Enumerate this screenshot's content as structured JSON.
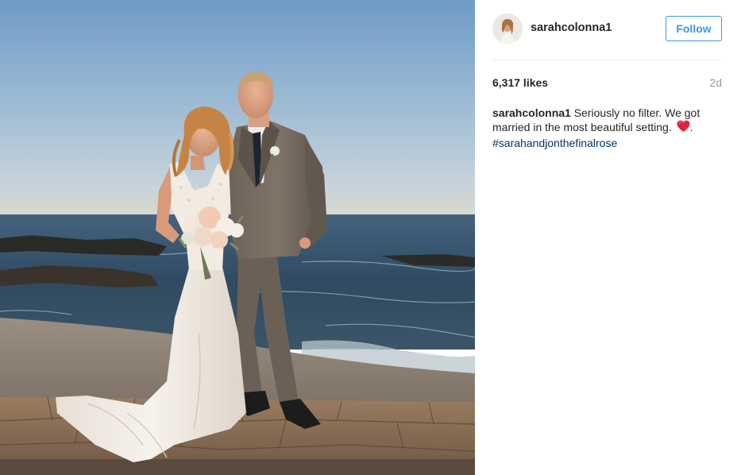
{
  "photo": {
    "alt": "wedding-photo-couple-on-beach"
  },
  "header": {
    "username": "sarahcolonna1",
    "follow_label": "Follow",
    "avatar_icon": "user-avatar"
  },
  "stats": {
    "likes": "6,317 likes",
    "age": "2d"
  },
  "caption": {
    "user": "sarahcolonna1",
    "text": "Seriously no filter. We got married in the most beautiful setting.",
    "emoji_icon": "red-heart-icon",
    "trailing": ".",
    "hashtag": "#sarahandjonthefinalrose"
  },
  "colors": {
    "link": "#003569",
    "follow": "#3897f0",
    "muted": "#999999"
  }
}
